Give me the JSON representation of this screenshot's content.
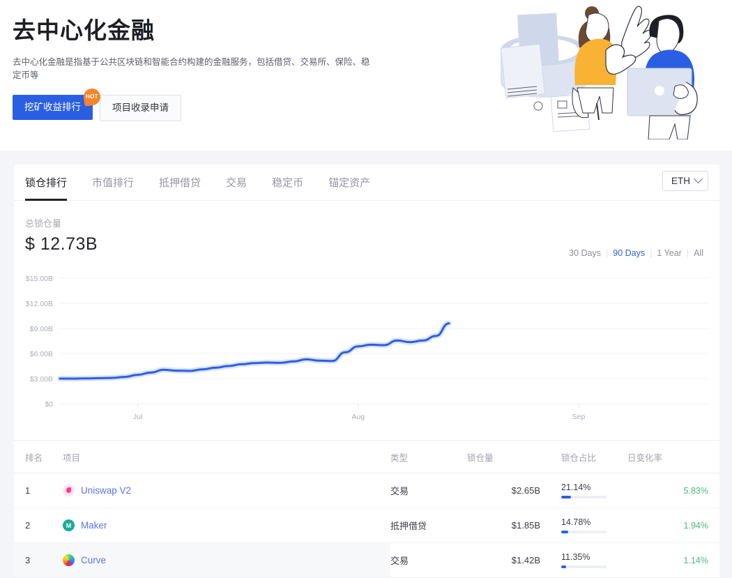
{
  "hero": {
    "title": "去中心化金融",
    "description": "去中心化金融是指基于公共区块链和智能合约构建的金融服务，包括借贷、交易所、保险、稳定币等",
    "primary_button": "挖矿收益排行",
    "hot_badge": "HOT",
    "secondary_button": "项目收录申请",
    "illustration": "people-with-laptop-illustration"
  },
  "card": {
    "tabs": [
      {
        "label": "锁仓排行",
        "active": true
      },
      {
        "label": "市值排行",
        "active": false
      },
      {
        "label": "抵押借贷",
        "active": false
      },
      {
        "label": "交易",
        "active": false
      },
      {
        "label": "稳定币",
        "active": false
      },
      {
        "label": "锚定资产",
        "active": false
      }
    ],
    "chain_select": {
      "value": "ETH",
      "icon": "chevron-down-icon"
    },
    "summary": {
      "label": "总锁仓量",
      "value": "$ 12.73B"
    },
    "ranges": [
      {
        "label": "30 Days",
        "active": false
      },
      {
        "label": "90 Days",
        "active": true
      },
      {
        "label": "1 Year",
        "active": false
      },
      {
        "label": "All",
        "active": false
      }
    ]
  },
  "chart_data": {
    "type": "line",
    "title": "总锁仓量",
    "xlabel": "",
    "ylabel": "",
    "grid": true,
    "legend": null,
    "line_color": "#2b5fe3",
    "ylim": [
      0,
      15
    ],
    "yticks": [
      0,
      3,
      6,
      9,
      12,
      15
    ],
    "ytick_labels": [
      "$0",
      "$3.00B",
      "$6.00B",
      "$9.00B",
      "$12.00B",
      "$15.00B"
    ],
    "xtick_labels": [
      "Jul",
      "Aug",
      "Sep"
    ],
    "xtick_positions": [
      0.12,
      0.46,
      0.8
    ],
    "x": [
      0.0,
      0.02,
      0.04,
      0.06,
      0.08,
      0.1,
      0.12,
      0.14,
      0.16,
      0.18,
      0.2,
      0.22,
      0.24,
      0.26,
      0.28,
      0.3,
      0.32,
      0.34,
      0.36,
      0.38,
      0.4,
      0.42,
      0.44,
      0.46,
      0.48,
      0.5,
      0.52,
      0.54,
      0.56,
      0.58
    ],
    "values": [
      3.0,
      3.0,
      3.02,
      3.05,
      3.08,
      3.2,
      3.45,
      3.72,
      4.05,
      3.95,
      3.92,
      4.1,
      4.3,
      4.5,
      4.72,
      4.85,
      4.92,
      4.88,
      5.05,
      5.3,
      5.15,
      5.1,
      6.15,
      6.85,
      7.05,
      7.0,
      7.55,
      7.35,
      7.55,
      8.1
    ],
    "final_value": 9.6,
    "units": "billion USD"
  },
  "table": {
    "headers": {
      "rank": "排名",
      "project": "项目",
      "type": "类型",
      "tvl": "锁仓量",
      "share": "锁仓占比",
      "change": "日变化率"
    },
    "rows": [
      {
        "rank": "1",
        "icon": "uniswap-icon",
        "project": "Uniswap V2",
        "type": "交易",
        "tvl": "$2.65B",
        "share": "21.14%",
        "share_pct": 21.14,
        "change": "5.83%",
        "highlight": false
      },
      {
        "rank": "2",
        "icon": "maker-icon",
        "project": "Maker",
        "type": "抵押借贷",
        "tvl": "$1.85B",
        "share": "14.78%",
        "share_pct": 14.78,
        "change": "1.94%",
        "highlight": false
      },
      {
        "rank": "3",
        "icon": "curve-icon",
        "project": "Curve",
        "type": "交易",
        "tvl": "$1.42B",
        "share": "11.35%",
        "share_pct": 11.35,
        "change": "1.14%",
        "highlight": true
      }
    ]
  },
  "colors": {
    "accent": "#2b5fe3",
    "positive": "#4cb87a",
    "badge": "#f5852a",
    "page_bg": "#f4f5f9"
  }
}
